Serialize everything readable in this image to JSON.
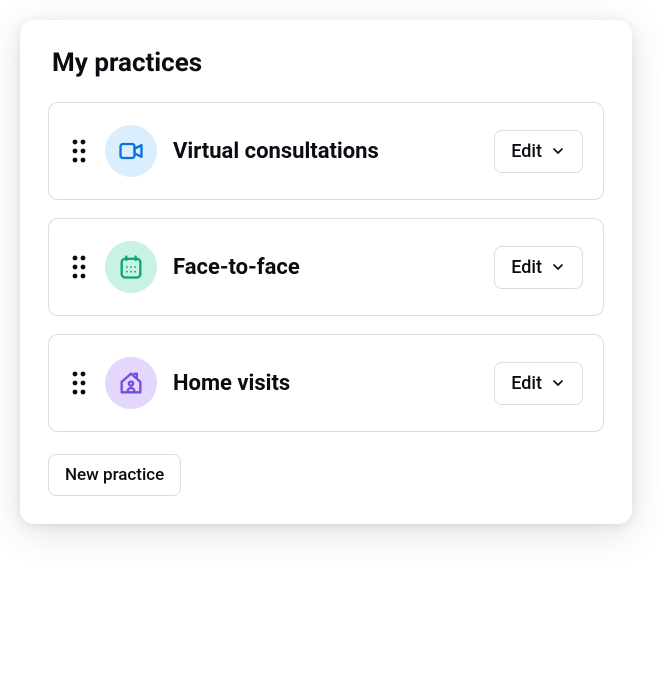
{
  "title": "My practices",
  "practices": [
    {
      "label": "Virtual consultations",
      "icon": "video",
      "badge_bg": "#dbeefd",
      "icon_color": "#0a72df",
      "edit_label": "Edit"
    },
    {
      "label": "Face-to-face",
      "icon": "calendar",
      "badge_bg": "#c9f2e2",
      "icon_color": "#0aa77a",
      "edit_label": "Edit"
    },
    {
      "label": "Home visits",
      "icon": "home-person",
      "badge_bg": "#e3d7fb",
      "icon_color": "#7a49e6",
      "edit_label": "Edit"
    }
  ],
  "new_practice_label": "New practice"
}
